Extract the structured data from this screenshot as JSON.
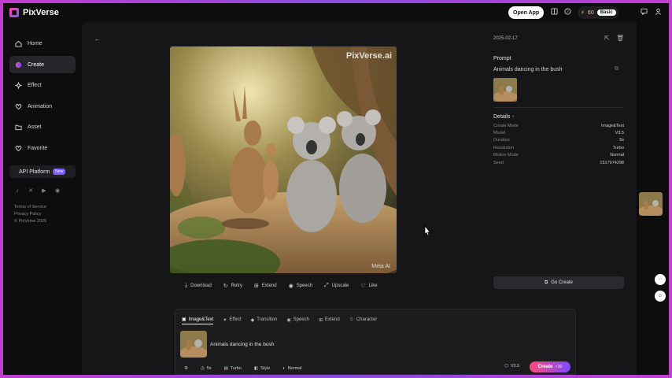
{
  "app": {
    "name": "PixVerse"
  },
  "topbar": {
    "open_app_label": "Open App",
    "credits": "60",
    "plan_badge": "Basic",
    "icons": [
      "layout-icon",
      "help-icon",
      "bolt-icon",
      "message-icon",
      "user-icon"
    ]
  },
  "sidebar": {
    "items": [
      {
        "label": "Home",
        "icon": "home-icon"
      },
      {
        "label": "Create",
        "icon": "create-icon",
        "active": true
      },
      {
        "label": "Effect",
        "icon": "sparkle-icon"
      },
      {
        "label": "Animation",
        "icon": "heart-icon"
      },
      {
        "label": "Asset",
        "icon": "folder-icon"
      },
      {
        "label": "Favorite",
        "icon": "heart-icon"
      }
    ],
    "api_label": "API Platform",
    "api_badge": "New",
    "socials": [
      "tiktok-icon",
      "x-icon",
      "youtube-icon",
      "discord-icon"
    ],
    "footer": [
      "Terms of Service",
      "Privacy Policy",
      "© PixVerse 2025"
    ]
  },
  "media": {
    "watermark_top": "PixVerse.ai",
    "watermark_bottom": "Meta AI"
  },
  "actions": [
    {
      "label": "Download",
      "icon": "download-icon"
    },
    {
      "label": "Retry",
      "icon": "retry-icon"
    },
    {
      "label": "Extend",
      "icon": "extend-icon"
    },
    {
      "label": "Speech",
      "icon": "speech-icon"
    },
    {
      "label": "Upscale",
      "icon": "upscale-icon"
    },
    {
      "label": "Like",
      "icon": "heart-icon"
    }
  ],
  "details": {
    "date": "2025-02-17",
    "prompt_title": "Prompt",
    "prompt_text": "Animals dancing in the bush",
    "details_title": "Details",
    "rows": [
      {
        "k": "Create Mode",
        "v": "Image&Text"
      },
      {
        "k": "Model",
        "v": "V3.5"
      },
      {
        "k": "Duration",
        "v": "5s"
      },
      {
        "k": "Resolution",
        "v": "Turbo"
      },
      {
        "k": "Motion Mode",
        "v": "Normal"
      },
      {
        "k": "Seed",
        "v": "1517974298"
      }
    ],
    "go_create_label": "Go Create"
  },
  "composer": {
    "tabs": [
      {
        "label": "Image&Text",
        "active": true
      },
      {
        "label": "Effect"
      },
      {
        "label": "Transition"
      },
      {
        "label": "Speech"
      },
      {
        "label": "Extend"
      },
      {
        "label": "Character"
      }
    ],
    "prompt": "Animals dancing in the bush",
    "options": [
      {
        "label": "",
        "icon": "sliders-icon"
      },
      {
        "label": "5s",
        "icon": "clock-icon"
      },
      {
        "label": "Turbo",
        "icon": "turbo-icon"
      },
      {
        "label": "Style",
        "icon": "style-icon"
      },
      {
        "label": "Normal",
        "icon": "motion-icon"
      }
    ],
    "model": "V3.5",
    "create_label": "Create",
    "create_cost": "⚡30"
  },
  "colors": {
    "background": "#0d0d0e",
    "panel": "#161618",
    "accent_gradient": [
      "#ff4a7a",
      "#7a4bff"
    ],
    "frame": "#c13fd0"
  }
}
